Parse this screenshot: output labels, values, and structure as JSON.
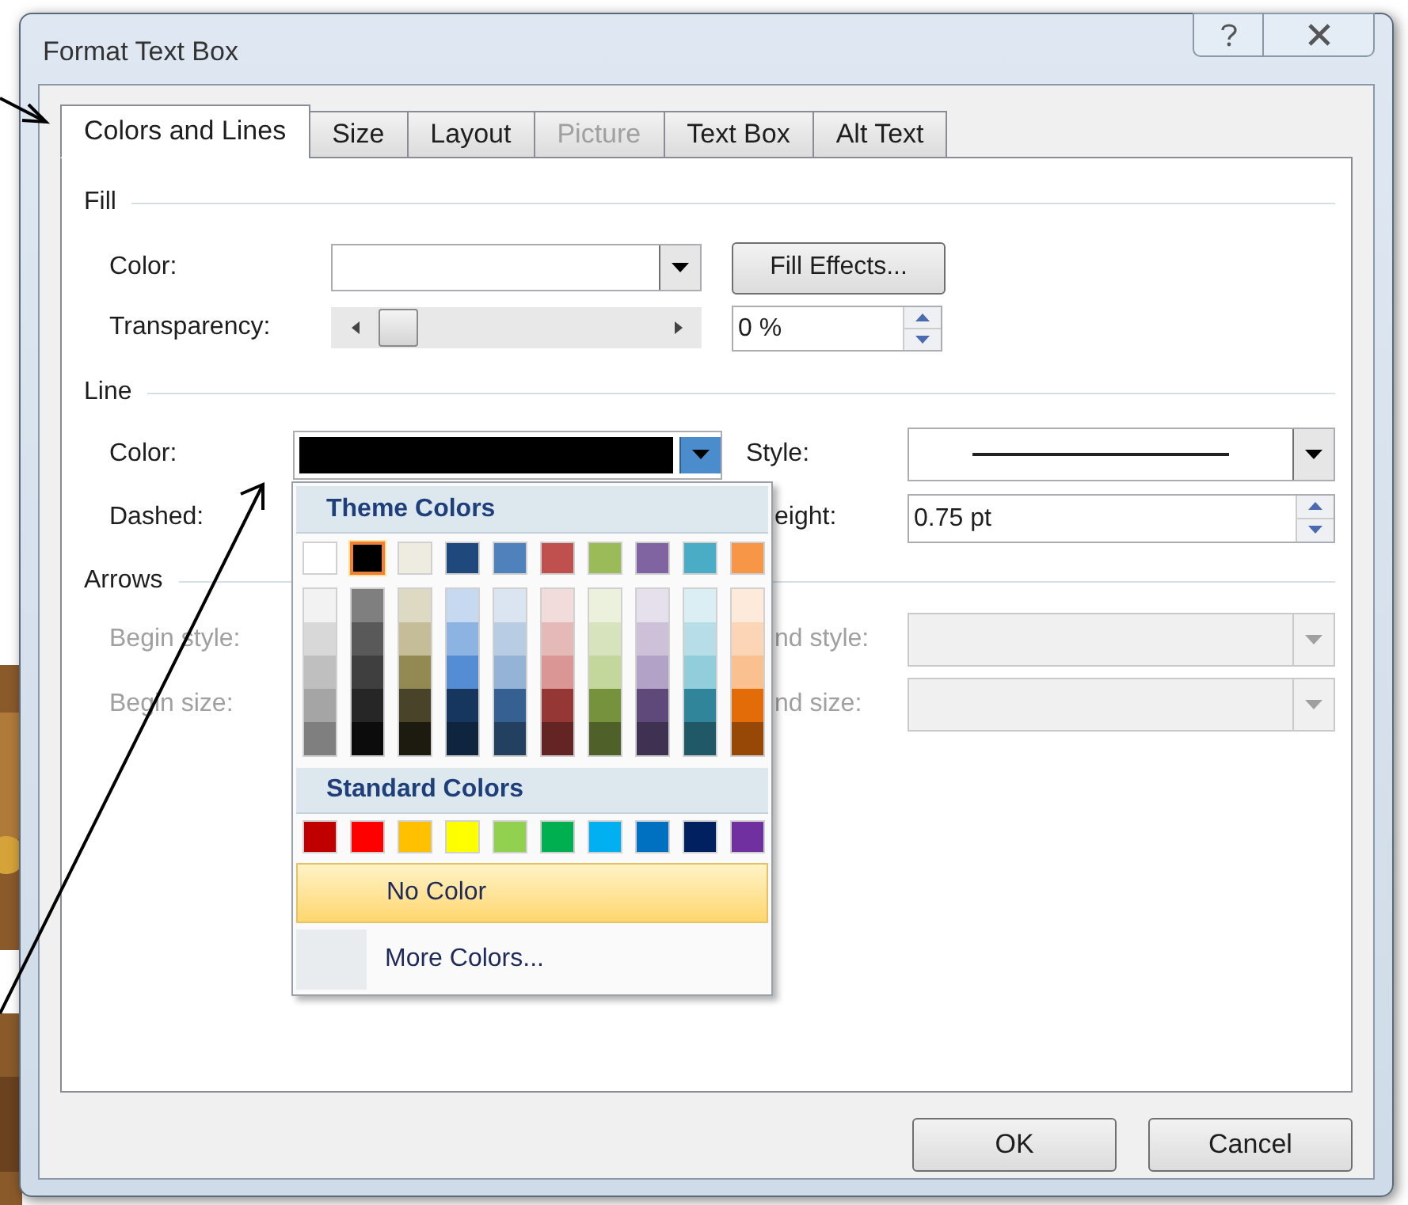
{
  "window": {
    "title": "Format Text Box"
  },
  "tabs": [
    {
      "label": "Colors and Lines",
      "selected": true,
      "disabled": false
    },
    {
      "label": "Size",
      "selected": false,
      "disabled": false
    },
    {
      "label": "Layout",
      "selected": false,
      "disabled": false
    },
    {
      "label": "Picture",
      "selected": false,
      "disabled": true
    },
    {
      "label": "Text Box",
      "selected": false,
      "disabled": false
    },
    {
      "label": "Alt Text",
      "selected": false,
      "disabled": false
    }
  ],
  "fill": {
    "heading": "Fill",
    "color_label": "Color:",
    "fill_effects_button": "Fill Effects...",
    "transparency_label": "Transparency:",
    "transparency": {
      "level": 0
    },
    "transparency_value": "0 %"
  },
  "line": {
    "heading": "Line",
    "color_label": "Color:",
    "color": "#000000",
    "style_label": "Style:",
    "dashed_label": "Dashed:",
    "weight_label": "eight:",
    "weight_value": "0.75 pt"
  },
  "arrows": {
    "heading": "Arrows",
    "rows": [
      {
        "begin_label": "Begin style:",
        "end_label": "nd style:",
        "disabled": true
      },
      {
        "begin_label": "Begin size:",
        "end_label": "nd size:",
        "disabled": true
      }
    ]
  },
  "color_menu": {
    "theme_heading": "Theme Colors",
    "theme_colors": [
      {
        "color": "#ffffff",
        "selected": false,
        "shades": [
          {
            "color": "#f2f2f2"
          },
          {
            "color": "#d8d8d8"
          },
          {
            "color": "#bfbfbf"
          },
          {
            "color": "#a5a5a5"
          },
          {
            "color": "#7f7f7f"
          }
        ]
      },
      {
        "color": "#000000",
        "selected": true,
        "shades": [
          {
            "color": "#7f7f7f"
          },
          {
            "color": "#595959"
          },
          {
            "color": "#3f3f3f"
          },
          {
            "color": "#262626"
          },
          {
            "color": "#0c0c0c"
          }
        ]
      },
      {
        "color": "#eeece1",
        "selected": false,
        "shades": [
          {
            "color": "#ddd9c3"
          },
          {
            "color": "#c4bd97"
          },
          {
            "color": "#938953"
          },
          {
            "color": "#494429"
          },
          {
            "color": "#1d1b10"
          }
        ]
      },
      {
        "color": "#1f497d",
        "selected": false,
        "shades": [
          {
            "color": "#c6d9f0"
          },
          {
            "color": "#8db3e2"
          },
          {
            "color": "#548dd4"
          },
          {
            "color": "#17365d"
          },
          {
            "color": "#0f243e"
          }
        ]
      },
      {
        "color": "#4f81bd",
        "selected": false,
        "shades": [
          {
            "color": "#dbe5f1"
          },
          {
            "color": "#b8cce4"
          },
          {
            "color": "#95b3d7"
          },
          {
            "color": "#366092"
          },
          {
            "color": "#244061"
          }
        ]
      },
      {
        "color": "#c0504d",
        "selected": false,
        "shades": [
          {
            "color": "#f2dcdb"
          },
          {
            "color": "#e5b9b7"
          },
          {
            "color": "#d99694"
          },
          {
            "color": "#953734"
          },
          {
            "color": "#632423"
          }
        ]
      },
      {
        "color": "#9bbb59",
        "selected": false,
        "shades": [
          {
            "color": "#ebf1dd"
          },
          {
            "color": "#d7e3bc"
          },
          {
            "color": "#c3d69b"
          },
          {
            "color": "#76923c"
          },
          {
            "color": "#4f6128"
          }
        ]
      },
      {
        "color": "#8064a2",
        "selected": false,
        "shades": [
          {
            "color": "#e5e0ec"
          },
          {
            "color": "#ccc1d9"
          },
          {
            "color": "#b2a2c7"
          },
          {
            "color": "#5f497a"
          },
          {
            "color": "#3f3151"
          }
        ]
      },
      {
        "color": "#4bacc6",
        "selected": false,
        "shades": [
          {
            "color": "#dbeef3"
          },
          {
            "color": "#b7dde8"
          },
          {
            "color": "#92cddc"
          },
          {
            "color": "#31859b"
          },
          {
            "color": "#205867"
          }
        ]
      },
      {
        "color": "#f79646",
        "selected": false,
        "shades": [
          {
            "color": "#fdeada"
          },
          {
            "color": "#fbd5b5"
          },
          {
            "color": "#fac08f"
          },
          {
            "color": "#e36c09"
          },
          {
            "color": "#974806"
          }
        ]
      }
    ],
    "standard_heading": "Standard Colors",
    "standard_colors": [
      {
        "color": "#c00000"
      },
      {
        "color": "#ff0000"
      },
      {
        "color": "#ffc000"
      },
      {
        "color": "#ffff00"
      },
      {
        "color": "#92d050"
      },
      {
        "color": "#00b050"
      },
      {
        "color": "#00b0f0"
      },
      {
        "color": "#0070c0"
      },
      {
        "color": "#002060"
      },
      {
        "color": "#7030a0"
      }
    ],
    "items": [
      {
        "label": "No Color",
        "selected": true
      },
      {
        "label": "More Colors...",
        "selected": false
      }
    ]
  },
  "buttons": [
    {
      "label": "OK"
    },
    {
      "label": "Cancel"
    }
  ]
}
